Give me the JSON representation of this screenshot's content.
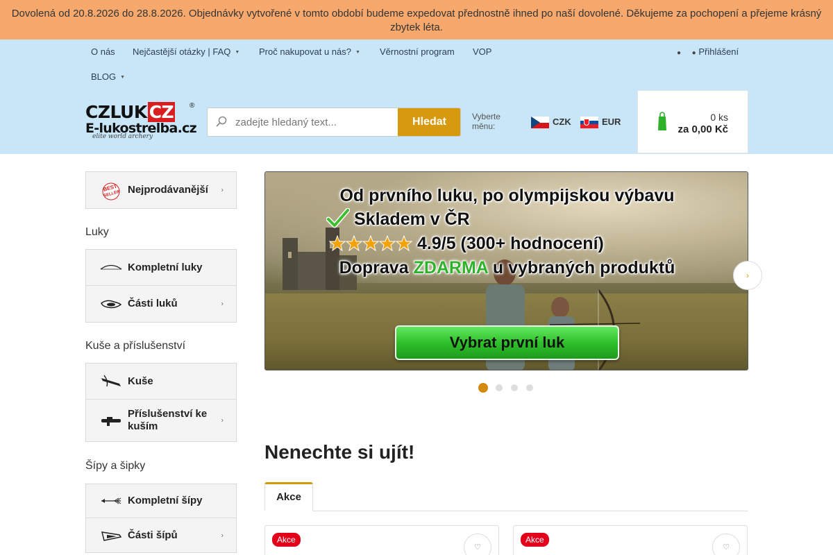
{
  "notice": {
    "text": "Dovolená od 20.8.2026 do 28.8.2026. Objednávky vytvořené v tomto období budeme expedovat přednostně ihned po naší dovolené. Děkujeme za pochopení a přejeme krásný zbytek léta."
  },
  "topnav": {
    "items": [
      {
        "label": "O nás"
      },
      {
        "label": "Nejčastější otázky | FAQ"
      },
      {
        "label": "Proč nakupovat u nás?"
      },
      {
        "label": "Věrnostní program"
      },
      {
        "label": "VOP"
      },
      {
        "label": "BLOG"
      }
    ],
    "login_label": "Přihlášení"
  },
  "logo": {
    "line1_a": "CZLUK",
    "line1_b": "CZ",
    "line2": "E-lukostrelba.cz",
    "line3": "elite world archery",
    "reg": "®"
  },
  "search": {
    "placeholder": "zadejte hledaný text...",
    "button_label": "Hledat"
  },
  "currency": {
    "label": "Vyberte měnu:",
    "options": [
      {
        "code": "CZK"
      },
      {
        "code": "EUR"
      }
    ]
  },
  "cart": {
    "count": "0 ks",
    "total": "za 0,00 Kč"
  },
  "sidebar": {
    "bestsellers": {
      "label": "Nejprodávanější",
      "badge_text": "BEST SELLER"
    },
    "sections": [
      {
        "title": "Luky",
        "items": [
          {
            "label": "Kompletní luky"
          },
          {
            "label": "Části luků"
          }
        ]
      },
      {
        "title": "Kuše a příslušenství",
        "items": [
          {
            "label": "Kuše"
          },
          {
            "label": "Příslušenství ke kuším"
          }
        ]
      },
      {
        "title": "Šípy a šipky",
        "items": [
          {
            "label": "Kompletní šípy"
          },
          {
            "label": "Části šípů"
          }
        ]
      }
    ]
  },
  "banner": {
    "line1": "Od prvního luku, po olympijskou výbavu",
    "line2": "Skladem v ČR",
    "line3": "4.9/5 (300+ hodnocení)",
    "line4_a": "Doprava ",
    "line4_b": "ZDARMA",
    "line4_c": " u vybraných produktů",
    "cta": "Vybrat první luk"
  },
  "slider": {
    "slides_total": 4,
    "active_index": 0
  },
  "promo": {
    "title": "Nenechte si ujít!",
    "tabs": [
      {
        "label": "Akce"
      }
    ],
    "cards": [
      {
        "badge": "Akce"
      },
      {
        "badge": "Akce"
      }
    ]
  },
  "colors": {
    "accent": "#d79a0e",
    "notice_bg": "#f7a86c",
    "header_bg": "#c8e6f7",
    "badge_red": "#e3001b",
    "banner_green": "#2fb12b"
  }
}
